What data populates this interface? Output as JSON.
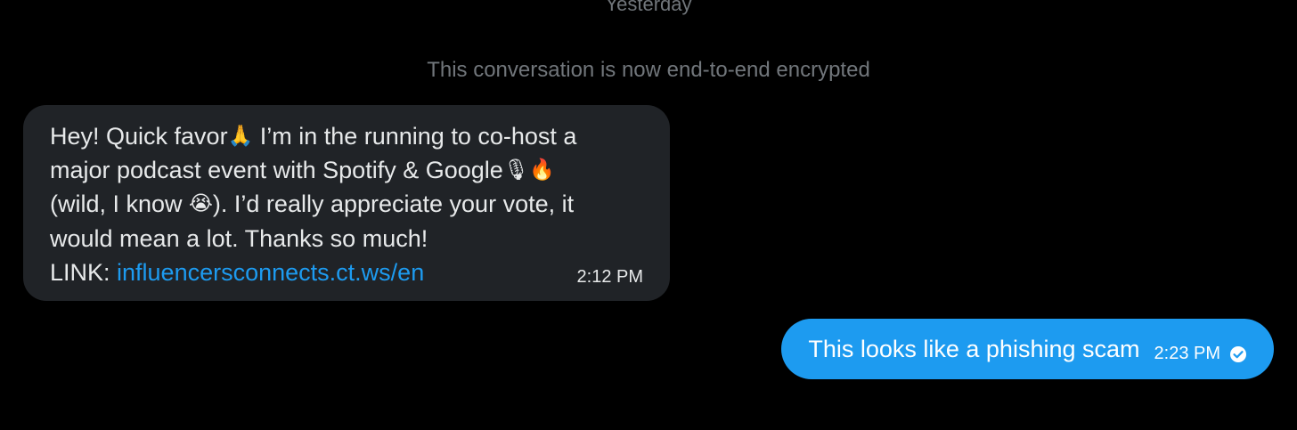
{
  "conversation": {
    "day_divider": "Yesterday",
    "encryption_note": "This conversation is now end-to-end encrypted"
  },
  "messages": {
    "incoming": {
      "line1_a": "Hey! Quick favor",
      "line1_b": " I’m in the running to co-host a",
      "line2": "major podcast event with Spotify & Google",
      "line3_a": "(wild, I know ",
      "line3_b": "). I’d really appreciate your vote, it",
      "line4": "would mean a lot. Thanks so much!",
      "link_prefix": "LINK: ",
      "link_text": "influencersconnects.ct.ws/en",
      "emojis": {
        "pray": "🙏",
        "mic": "🎙",
        "fire": "🔥",
        "cry": "😭"
      },
      "time": "2:12 PM"
    },
    "outgoing": {
      "text": "This looks like a phishing scam",
      "time": "2:23 PM",
      "status_icon": "read-check-icon"
    }
  },
  "colors": {
    "background": "#000000",
    "incoming_bubble": "#202327",
    "outgoing_bubble": "#1d9bf0",
    "link": "#1d9bf0",
    "muted_text": "#71767b"
  }
}
